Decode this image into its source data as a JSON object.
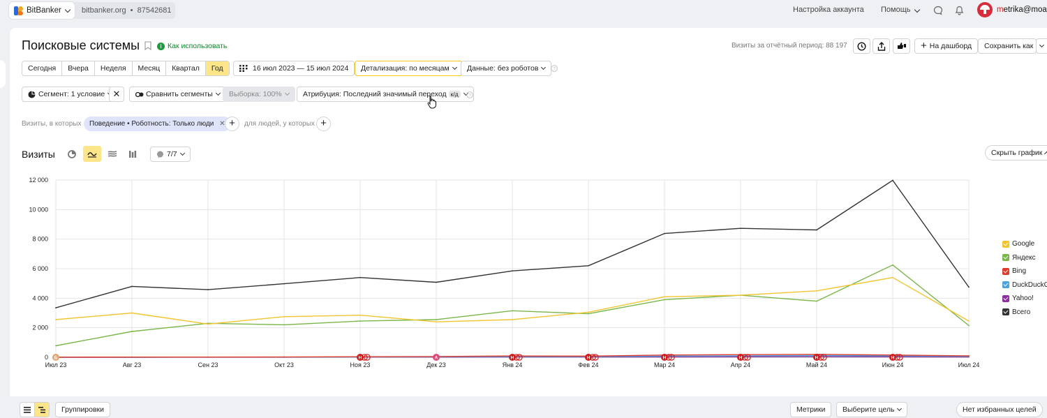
{
  "topbar": {
    "app_name": "BitBanker",
    "site_host": "bitbanker.org",
    "site_sep": "•",
    "counter_id": "87542681",
    "account_settings": "Настройка аккаунта",
    "help": "Помощь",
    "user_email_prefix": "m",
    "user_email_rest": "etrika@moab",
    "icons": [
      "chat-icon",
      "bell-icon"
    ]
  },
  "header": {
    "title": "Поисковые системы",
    "howto_label": "Как использовать",
    "visits_total": "Визиты за отчётный период: 88 197",
    "add_to_dashboard": "На дашборд",
    "save_as": "Сохранить как"
  },
  "periods": [
    "Сегодня",
    "Вчера",
    "Неделя",
    "Месяц",
    "Квартал",
    "Год"
  ],
  "active_period": "Год",
  "date_range": "16 июл 2023 — 15 июл 2024",
  "detail": "Детализация: по месяцам",
  "data_filter": "Данные: без роботов",
  "segment": "Сегмент: 1 условие",
  "compare_segments": "Сравнить сегменты",
  "sample": "Выборка: 100%",
  "attribution": "Атрибуция: Последний значимый переход",
  "attribution_badge": "к/д",
  "filter_row": {
    "visits_where": "Визиты, в которых",
    "chip_label": "Поведение • Роботность: Только люди",
    "people_where": "для людей, у которых"
  },
  "chart_header": {
    "title": "Визиты",
    "series_counter": "7/7",
    "hide_chart": "Скрыть график"
  },
  "chart_data": {
    "type": "line",
    "x": [
      "Июл 23",
      "Авг 23",
      "Сен 23",
      "Окт 23",
      "Ноя 23",
      "Дек 23",
      "Янв 24",
      "Фев 24",
      "Мар 24",
      "Апр 24",
      "Май 24",
      "Июн 24",
      "Июл 24"
    ],
    "ylim": [
      0,
      12000
    ],
    "yticks": [
      "0",
      "2 000",
      "4 000",
      "6 000",
      "8 000",
      "10 000",
      "12 000"
    ],
    "grid": true,
    "legend_position": "right",
    "series": [
      {
        "name": "Google",
        "color": "#f2c530",
        "values": [
          2550,
          3000,
          2250,
          2750,
          2850,
          2400,
          2550,
          3050,
          4100,
          4200,
          4500,
          5400,
          2450
        ]
      },
      {
        "name": "Яндекс",
        "color": "#7ab648",
        "values": [
          780,
          1750,
          2300,
          2200,
          2450,
          2550,
          3150,
          2950,
          3900,
          4200,
          3800,
          6250,
          2150
        ]
      },
      {
        "name": "Bing",
        "color": "#e03a2c",
        "values": [
          10,
          15,
          15,
          20,
          40,
          50,
          90,
          80,
          150,
          180,
          200,
          150,
          100
        ]
      },
      {
        "name": "DuckDuckGo",
        "color": "#4aa3df",
        "values": [
          5,
          5,
          10,
          10,
          20,
          30,
          50,
          50,
          80,
          100,
          120,
          100,
          60
        ]
      },
      {
        "name": "Yahoo!",
        "color": "#8e2ea0",
        "values": [
          2,
          2,
          5,
          5,
          10,
          10,
          20,
          20,
          30,
          40,
          50,
          40,
          20
        ]
      },
      {
        "name": "Всего",
        "color": "#333333",
        "values": [
          3350,
          4800,
          4580,
          4980,
          5400,
          5080,
          5850,
          6200,
          8380,
          8730,
          8620,
          11980,
          4750
        ]
      }
    ],
    "legend_labels": [
      "Google",
      "Яндекс",
      "Bing",
      "DuckDuckG",
      "Yahoo!",
      "Всего"
    ],
    "annotations": [
      {
        "x": "Июл 23",
        "label": "Б",
        "color": "#e5a470"
      },
      {
        "x": "Ноя 23",
        "label": "Н",
        "color": "#d11d1d"
      },
      {
        "x": "Дек 23",
        "label": "А",
        "color": "#e0487a"
      },
      {
        "x": "Янв 24",
        "label": "Н",
        "color": "#d11d1d"
      },
      {
        "x": "Фев 24",
        "label": "Н",
        "color": "#d11d1d"
      },
      {
        "x": "Мар 24",
        "label": "Н",
        "color": "#d11d1d"
      },
      {
        "x": "Апр 24",
        "label": "Н",
        "color": "#d11d1d"
      },
      {
        "x": "Май 24",
        "label": "Н",
        "color": "#d11d1d"
      },
      {
        "x": "Июн 24",
        "label": "Н",
        "color": "#d11d1d"
      }
    ]
  },
  "bottom": {
    "groupings": "Группировки",
    "metrics": "Метрики",
    "choose_goal": "Выберите цель",
    "no_favorite_goals": "Нет избранных целей"
  }
}
